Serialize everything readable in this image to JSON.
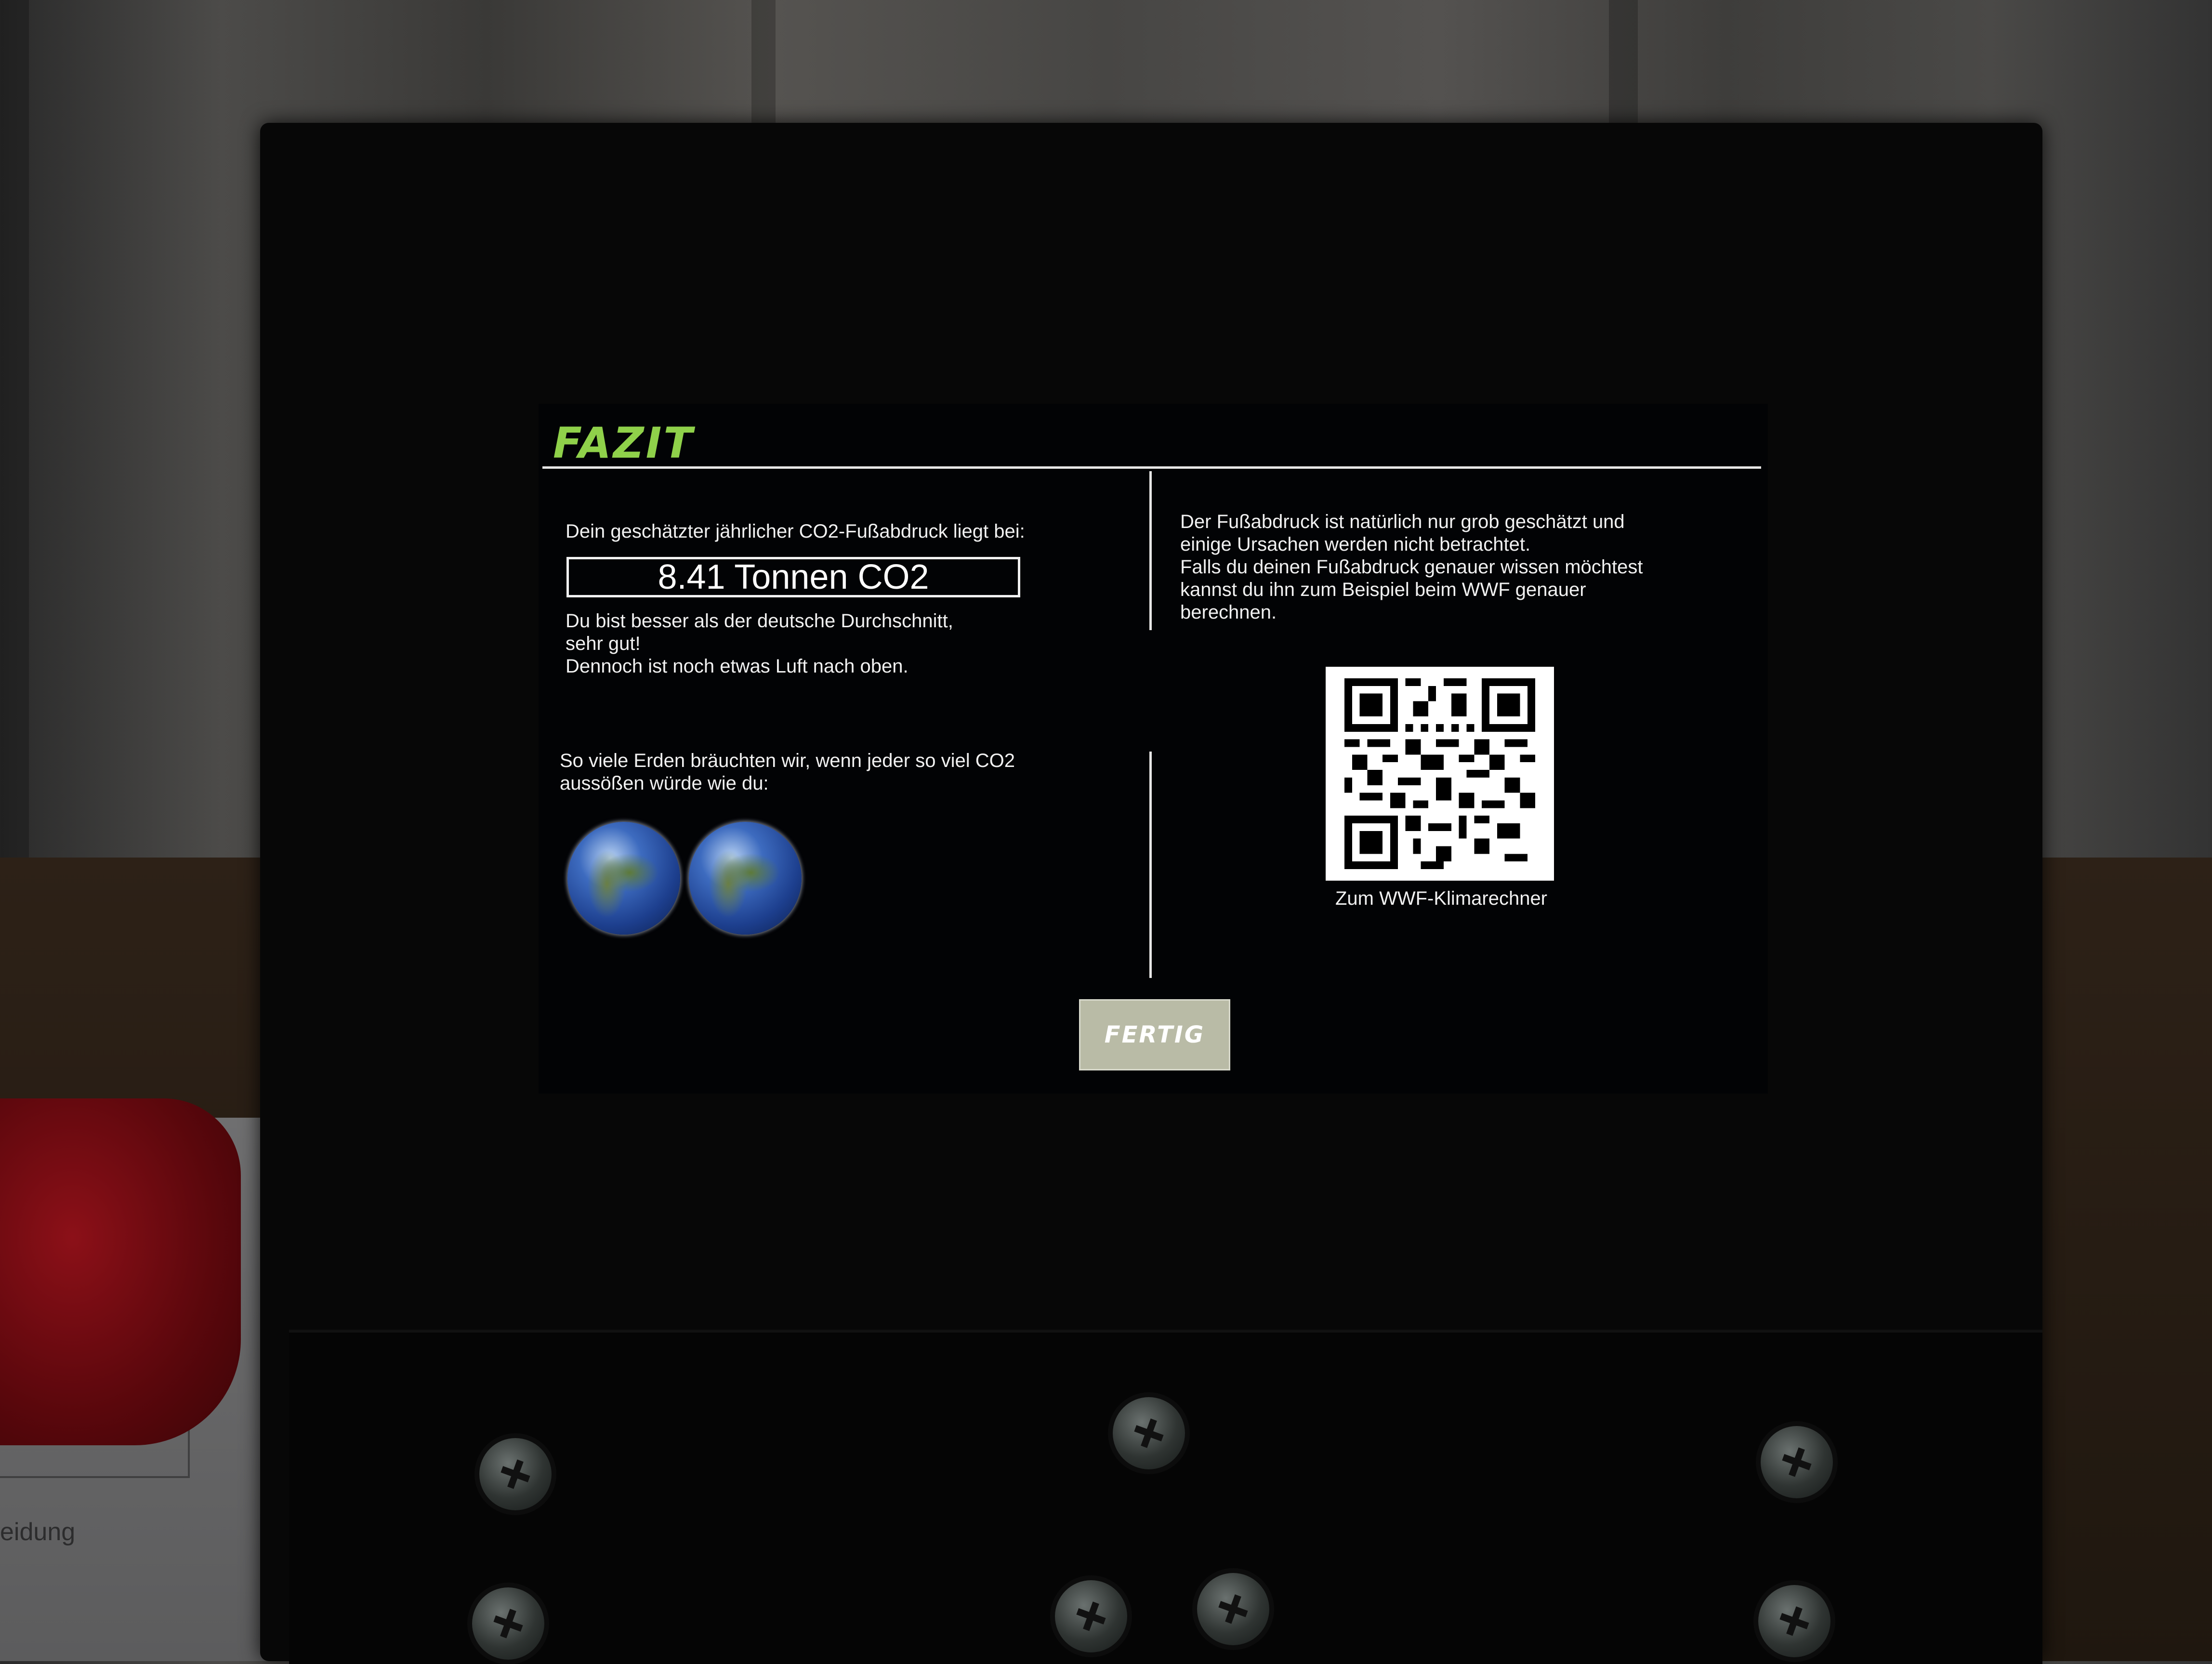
{
  "screen": {
    "title": "FAZIT",
    "left": {
      "intro": "Dein geschätzter jährlicher CO2-Fußabdruck liegt bei:",
      "footprint_value": "8.41 Tonnen CO2",
      "comparison": "Du bist besser als der deutsche Durchschnitt,\nsehr gut!\nDennoch ist noch etwas Luft nach oben.",
      "earths_label": "So viele Erden bräuchten wir, wenn jeder so viel CO2\naussößen würde wie du:",
      "earths_count": 2
    },
    "right": {
      "info": "Der Fußabdruck ist natürlich nur grob geschätzt und\neinige Ursachen werden nicht betrachtet.\nFalls du deinen Fußabdruck genauer wissen möchtest\nkannst du ihn zum Beispiel beim WWF genauer\nberechnen.",
      "qr_caption": "Zum WWF-Klimarechner"
    },
    "done_button": "FERTIG",
    "colors": {
      "title": "#8fd14a",
      "background": "#020305",
      "text": "#f1f1f1",
      "button": "#b9bba6"
    }
  },
  "background": {
    "paper_text": "eidung"
  }
}
